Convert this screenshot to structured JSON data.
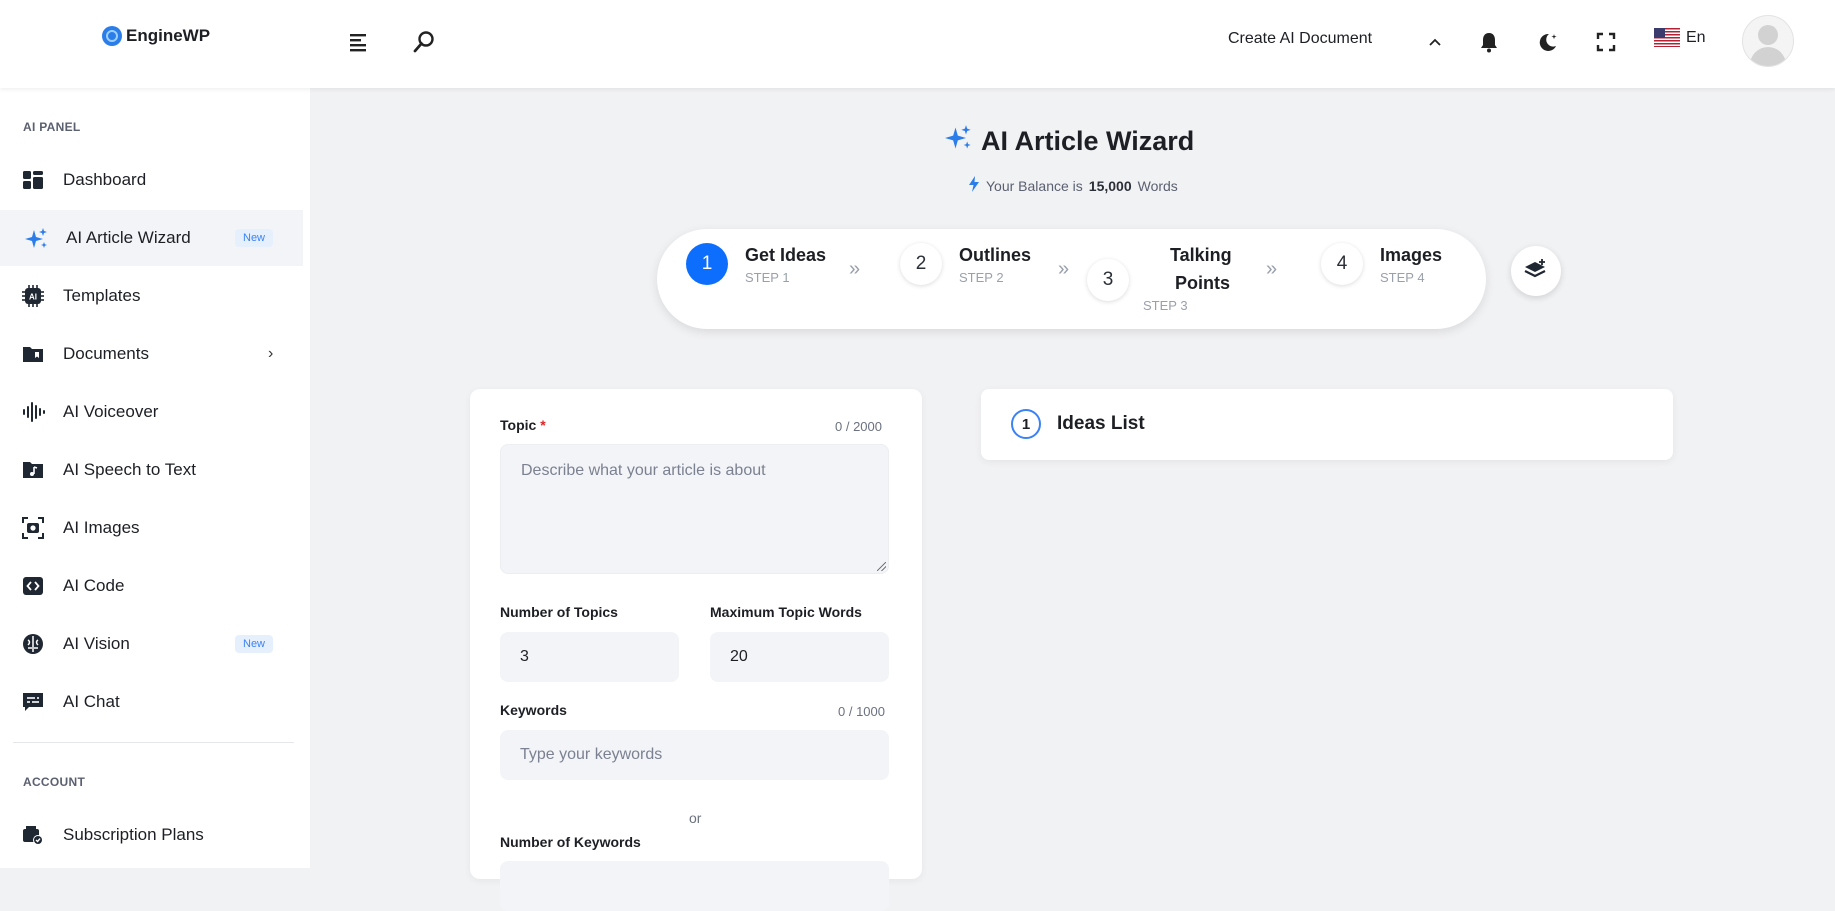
{
  "brand": {
    "name": "EngineWP"
  },
  "header": {
    "create_doc_label": "Create AI Document",
    "language": "En",
    "icons": [
      "menu-icon",
      "search-icon",
      "chevron-up-icon",
      "bell-icon",
      "moon-icon",
      "fullscreen-icon",
      "us-flag-icon",
      "avatar"
    ]
  },
  "sidebar": {
    "section_ai": "AI PANEL",
    "section_account": "ACCOUNT",
    "items": [
      {
        "label": "Dashboard",
        "icon": "dashboard-icon"
      },
      {
        "label": "AI Article Wizard",
        "icon": "sparkles-icon",
        "badge": "New",
        "active": true
      },
      {
        "label": "Templates",
        "icon": "chip-icon"
      },
      {
        "label": "Documents",
        "icon": "folder-icon",
        "chevron": "›"
      },
      {
        "label": "AI Voiceover",
        "icon": "waveform-icon"
      },
      {
        "label": "AI Speech to Text",
        "icon": "music-file-icon"
      },
      {
        "label": "AI Images",
        "icon": "camera-icon"
      },
      {
        "label": "AI Code",
        "icon": "code-icon"
      },
      {
        "label": "AI Vision",
        "icon": "brain-icon",
        "badge": "New"
      },
      {
        "label": "AI Chat",
        "icon": "chat-icon"
      }
    ],
    "account_items": [
      {
        "label": "Subscription Plans",
        "icon": "wallet-check-icon"
      }
    ]
  },
  "page": {
    "title": "AI Article Wizard",
    "balance_prefix": "Your Balance is",
    "balance_amount": "15,000",
    "balance_suffix": "Words"
  },
  "steps": [
    {
      "num": "1",
      "title": "Get Ideas",
      "sub": "STEP 1",
      "active": true
    },
    {
      "num": "2",
      "title": "Outlines",
      "sub": "STEP 2"
    },
    {
      "num": "3",
      "title_line1": "Talking",
      "title_line2": "Points",
      "sub": "STEP 3"
    },
    {
      "num": "4",
      "title": "Images",
      "sub": "STEP 4"
    }
  ],
  "form": {
    "topic_label": "Topic",
    "required_mark": "*",
    "topic_count": "0 / 2000",
    "topic_placeholder": "Describe what your article is about",
    "num_topics_label": "Number of Topics",
    "num_topics_value": "3",
    "max_words_label": "Maximum Topic Words",
    "max_words_value": "20",
    "keywords_label": "Keywords",
    "keywords_count": "0 / 1000",
    "keywords_placeholder": "Type your keywords",
    "or": "or",
    "num_keywords_label": "Number of Keywords"
  },
  "ideas": {
    "num": "1",
    "title": "Ideas List"
  },
  "colors": {
    "accent": "#0d6efd",
    "badge_bg": "#e6f0fd",
    "page_bg": "#f1f2f4"
  }
}
